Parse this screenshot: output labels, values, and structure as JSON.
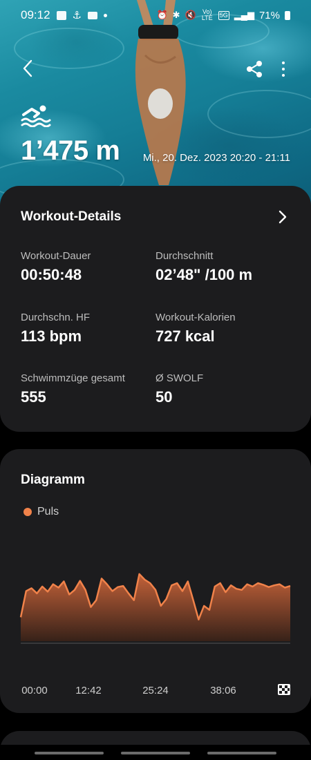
{
  "status_bar": {
    "time": "09:12",
    "battery": "71%",
    "volte": "Vo) LTE",
    "network": "5G"
  },
  "hero": {
    "distance": "1’475 m",
    "datetime": "Mi., 20. Dez. 2023 20:20 - 21:11",
    "activity_icon": "swimming-icon"
  },
  "details": {
    "title": "Workout-Details",
    "metrics": [
      {
        "label": "Workout-Dauer",
        "value": "00:50:48"
      },
      {
        "label": "Durchschnitt",
        "value": "02’48\" /100 m"
      },
      {
        "label": "Durchschn. HF",
        "value": "113 bpm"
      },
      {
        "label": "Workout-Kalorien",
        "value": "727 kcal"
      },
      {
        "label": "Schwimmzüge gesamt",
        "value": "555"
      },
      {
        "label": "Ø SWOLF",
        "value": "50"
      }
    ]
  },
  "chart": {
    "title": "Diagramm",
    "legend": "Puls",
    "accent": "#f0824a",
    "x_ticks": [
      "00:00",
      "12:42",
      "25:24",
      "38:06"
    ]
  },
  "chart_data": {
    "type": "area",
    "series": [
      {
        "name": "Puls",
        "x": [
          0,
          1,
          2,
          3,
          4,
          5,
          6,
          7,
          8,
          9,
          10,
          11,
          12,
          13,
          14,
          15,
          16,
          17,
          18,
          19,
          20,
          21,
          22,
          23,
          24,
          25,
          26,
          27,
          28,
          29,
          30,
          31,
          32,
          33,
          34,
          35,
          36,
          37,
          38,
          39,
          40,
          41,
          42,
          43,
          44,
          45,
          46,
          47,
          48,
          49,
          50
        ],
        "values": [
          0.42,
          0.88,
          0.93,
          0.84,
          0.96,
          0.87,
          1.0,
          0.94,
          1.05,
          0.82,
          0.9,
          1.06,
          0.9,
          0.6,
          0.72,
          1.1,
          1.0,
          0.88,
          0.95,
          0.97,
          0.84,
          0.72,
          1.18,
          1.08,
          1.02,
          0.9,
          0.62,
          0.74,
          0.98,
          1.02,
          0.88,
          1.05,
          0.72,
          0.38,
          0.62,
          0.55,
          0.96,
          1.02,
          0.86,
          0.98,
          0.92,
          0.9,
          1.0,
          0.96,
          1.02,
          0.99,
          0.95,
          0.98,
          1.0,
          0.94,
          0.97
        ]
      }
    ],
    "ylim": [
      0,
      1.25
    ],
    "grid": false
  },
  "next_card": {}
}
